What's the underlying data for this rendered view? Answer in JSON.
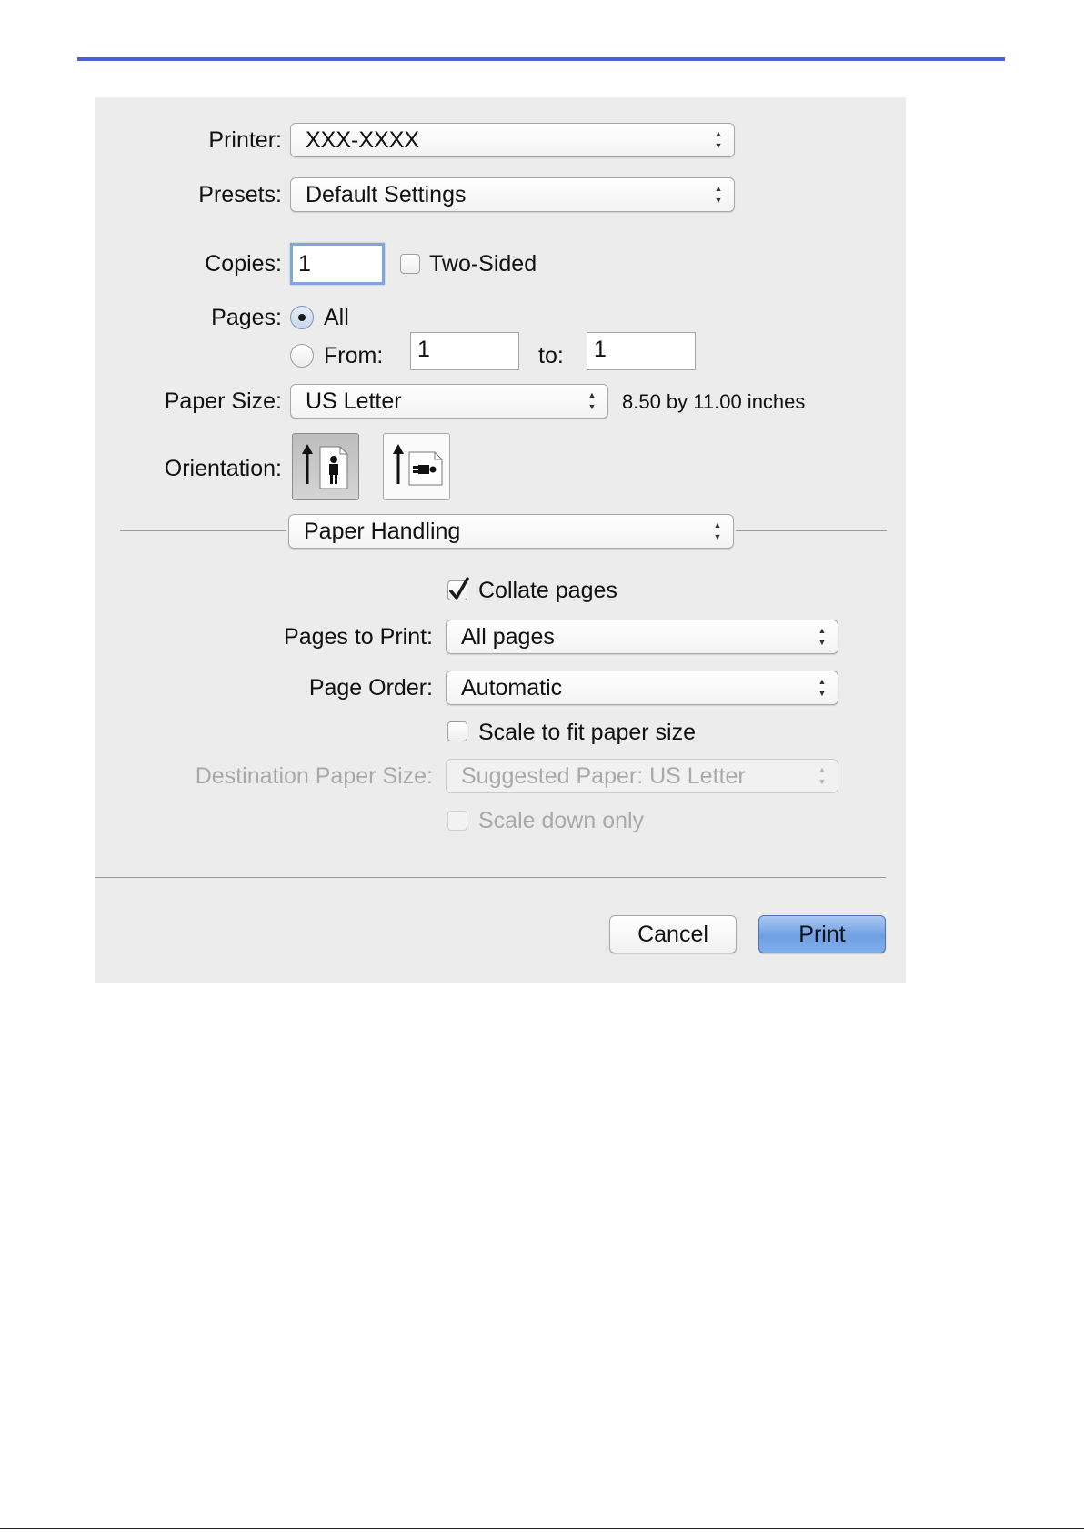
{
  "printer": {
    "label": "Printer:",
    "value": "XXX-XXXX"
  },
  "presets": {
    "label": "Presets:",
    "value": "Default Settings"
  },
  "copies": {
    "label": "Copies:",
    "value": "1",
    "two_sided_label": "Two-Sided",
    "two_sided_checked": false
  },
  "pages": {
    "label": "Pages:",
    "all_label": "All",
    "all_selected": true,
    "from_label": "From:",
    "from_value": "1",
    "to_label": "to:",
    "to_value": "1"
  },
  "paper_size": {
    "label": "Paper Size:",
    "value": "US Letter",
    "dimensions": "8.50 by 11.00 inches"
  },
  "orientation": {
    "label": "Orientation:",
    "selected": "portrait"
  },
  "section_popup": {
    "value": "Paper Handling"
  },
  "paper_handling": {
    "collate_label": "Collate pages",
    "collate_checked": true,
    "pages_to_print_label": "Pages to Print:",
    "pages_to_print_value": "All pages",
    "page_order_label": "Page Order:",
    "page_order_value": "Automatic",
    "scale_fit_label": "Scale to fit paper size",
    "scale_fit_checked": false,
    "dest_paper_label": "Destination Paper Size:",
    "dest_paper_value": "Suggested Paper: US Letter",
    "scale_down_label": "Scale down only",
    "scale_down_checked": false
  },
  "buttons": {
    "cancel": "Cancel",
    "print": "Print"
  },
  "colors": {
    "accent_rule": "#4a5fd0",
    "default_button": "#6e9fe3",
    "dialog_bg": "#ececec"
  }
}
